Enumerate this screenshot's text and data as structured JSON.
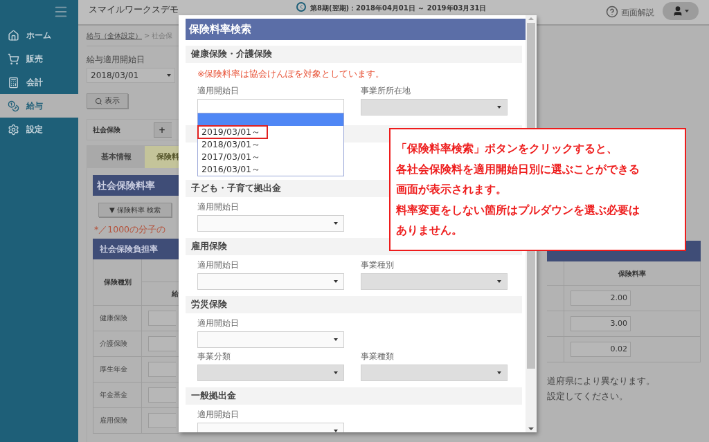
{
  "sidebar": {
    "items": [
      {
        "label": "ホーム",
        "selected": false
      },
      {
        "label": "販売",
        "selected": false
      },
      {
        "label": "会計",
        "selected": false
      },
      {
        "label": "給与",
        "selected": true
      },
      {
        "label": "設定",
        "selected": false
      }
    ]
  },
  "header": {
    "company": "スマイルワークスデモ",
    "period": "第8期(翌期)：2018年04月01日 ～ 2019年03月31日",
    "help": "画面解説"
  },
  "breadcrumb": {
    "link": "給与（全体設定）",
    "separator": ">",
    "current": "社会保"
  },
  "start_date": {
    "label": "給与適用開始日",
    "value": "2018/03/01"
  },
  "show_button": "表示",
  "panel": {
    "title": "社会保険",
    "add_button": "+"
  },
  "tabs": [
    {
      "label": "基本情報",
      "selected": false
    },
    {
      "label": "保険料",
      "selected": true
    }
  ],
  "section_title": "社会保険料率",
  "search_button": "▼ 保険料率 検索",
  "note": "*／1000の分子の",
  "table": {
    "title": "社会保険負担率",
    "columns": [
      "保険種別",
      "給"
    ],
    "rows": [
      "健康保険",
      "介護保険",
      "厚生年金",
      "年金基金",
      "雇用保険"
    ]
  },
  "rate_table": {
    "column": "保険料率",
    "values": [
      "2.00",
      "3.00",
      "0.02"
    ]
  },
  "right_notes": [
    "道府県により異なります。",
    "設定してください。"
  ],
  "modal": {
    "title": "保険料率検索",
    "sections": [
      {
        "title": "健康保険・介護保険",
        "note": "※保険料率は協会けんぽを対象としています。",
        "rows": [
          [
            {
              "label": "適用開始日",
              "disabled": false,
              "open": true
            },
            {
              "label": "事業所所在地",
              "disabled": true,
              "open": false
            }
          ]
        ]
      },
      {
        "title": "子ども・子育て拠出金",
        "rows": [
          [
            {
              "label": "適用開始日",
              "disabled": false,
              "open": false
            }
          ]
        ]
      },
      {
        "title": "雇用保険",
        "rows": [
          [
            {
              "label": "適用開始日",
              "disabled": false,
              "open": false
            },
            {
              "label": "事業種別",
              "disabled": true,
              "open": false
            }
          ]
        ]
      },
      {
        "title": "労災保険",
        "rows": [
          [
            {
              "label": "適用開始日",
              "disabled": false,
              "open": false
            }
          ],
          [
            {
              "label": "事業分類",
              "disabled": true,
              "open": false
            },
            {
              "label": "事業種類",
              "disabled": true,
              "open": false
            }
          ]
        ]
      },
      {
        "title": "一般拠出金",
        "rows": [
          [
            {
              "label": "適用開始日",
              "disabled": false,
              "open": false
            }
          ]
        ]
      }
    ],
    "options": [
      {
        "selected": true,
        "highlighted": false
      },
      {
        "label": "2019/03/01～",
        "selected": false,
        "highlighted": true
      },
      {
        "label": "2018/03/01～",
        "selected": false,
        "highlighted": false
      },
      {
        "label": "2017/03/01～",
        "selected": false,
        "highlighted": false
      },
      {
        "label": "2016/03/01～",
        "selected": false,
        "highlighted": false
      }
    ]
  },
  "callout": {
    "lines": [
      "「保険料率検索」ボタンをクリックすると、",
      "各社会保険料を適用開始日別に選ぶことができる",
      "画面が表示されます。",
      "料率変更をしない箇所はプルダウンを選ぶ必要は",
      "ありません。"
    ]
  }
}
